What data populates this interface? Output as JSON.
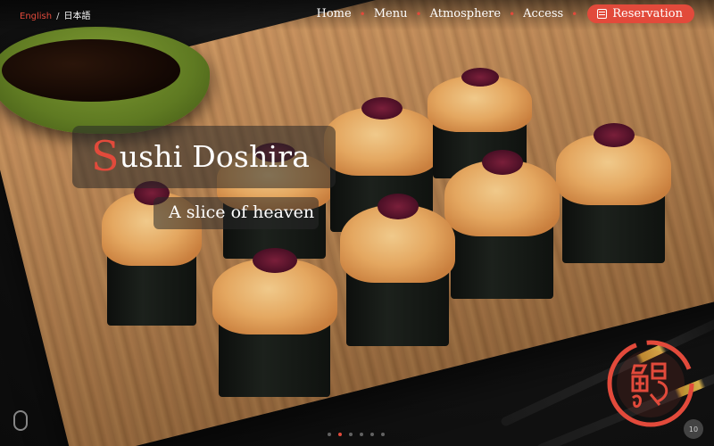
{
  "nav": {
    "lang_en": "English",
    "lang_sep": "/",
    "lang_ja": "日本語",
    "items": [
      "Home",
      "Menu",
      "Atmosphere",
      "Access"
    ],
    "reservation": "Reservation"
  },
  "hero": {
    "title_first": "S",
    "title_rest": "ushi Doshira",
    "subtitle": "A slice of heaven"
  },
  "slider": {
    "count": 6,
    "active": 1
  },
  "back_to_top": "10",
  "colors": {
    "accent": "#e24a3b"
  },
  "icons": {
    "reservation": "calendar-icon",
    "scroll": "mouse-scroll-icon",
    "logo": "doshira-seal-logo"
  }
}
